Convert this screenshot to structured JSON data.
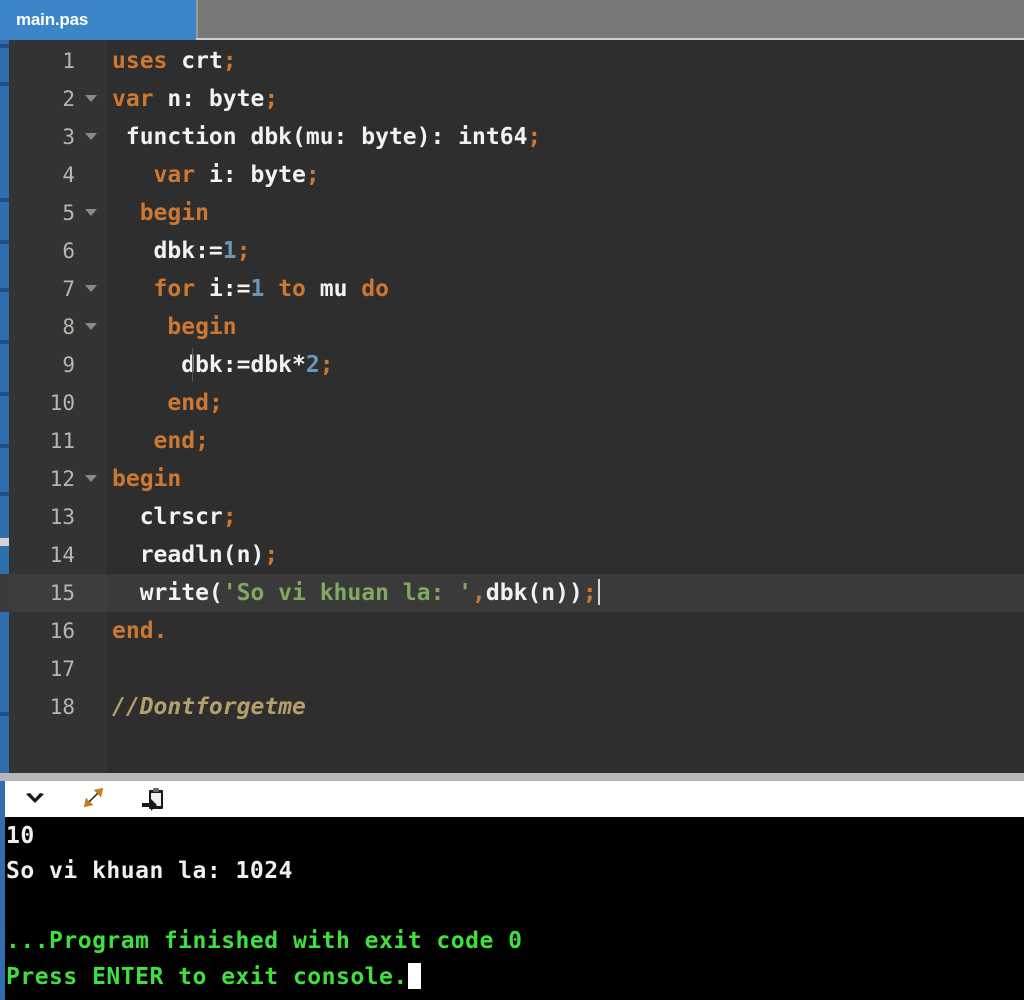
{
  "window": {
    "title": "main.pas",
    "theme": "dark-code-editor"
  },
  "colors": {
    "tab_active_bg": "#3a86c8",
    "tabbar_bg": "#787878",
    "editor_bg": "#2e2e2e",
    "gutter_bg": "#333333",
    "current_line_bg": "#3a3a3a",
    "keyword": "#cc7832",
    "number": "#6897bb",
    "string": "#81a85f",
    "comment": "#b3a06a",
    "identifier": "#f2f2f2",
    "console_bg": "#000000",
    "console_text": "#f0f0f0",
    "console_success": "#3ee03e",
    "accent_rail": "#2f6fb0"
  },
  "tabs": [
    {
      "label": "main.pas",
      "active": true
    }
  ],
  "editor": {
    "language": "pascal",
    "current_line": 15,
    "caret_line": 15,
    "lines": [
      {
        "n": 1,
        "fold": false,
        "indent_guide": false,
        "tokens": [
          {
            "t": "uses",
            "c": "kw"
          },
          {
            "t": " ",
            "c": "idn"
          },
          {
            "t": "crt",
            "c": "idn"
          },
          {
            "t": ";",
            "c": "pun"
          }
        ]
      },
      {
        "n": 2,
        "fold": true,
        "indent_guide": false,
        "tokens": [
          {
            "t": "var",
            "c": "kw"
          },
          {
            "t": " n: byte",
            "c": "idn"
          },
          {
            "t": ";",
            "c": "pun"
          }
        ]
      },
      {
        "n": 3,
        "fold": true,
        "indent_guide": false,
        "tokens": [
          {
            "t": " function dbk(mu: byte): int64",
            "c": "idn"
          },
          {
            "t": ";",
            "c": "pun"
          }
        ]
      },
      {
        "n": 4,
        "fold": false,
        "indent_guide": false,
        "tokens": [
          {
            "t": "   ",
            "c": "idn"
          },
          {
            "t": "var",
            "c": "kw"
          },
          {
            "t": " i: byte",
            "c": "idn"
          },
          {
            "t": ";",
            "c": "pun"
          }
        ]
      },
      {
        "n": 5,
        "fold": true,
        "indent_guide": false,
        "tokens": [
          {
            "t": "  ",
            "c": "idn"
          },
          {
            "t": "begin",
            "c": "kw"
          }
        ]
      },
      {
        "n": 6,
        "fold": false,
        "indent_guide": false,
        "tokens": [
          {
            "t": "   dbk:=",
            "c": "idn"
          },
          {
            "t": "1",
            "c": "num"
          },
          {
            "t": ";",
            "c": "pun"
          }
        ]
      },
      {
        "n": 7,
        "fold": true,
        "indent_guide": false,
        "tokens": [
          {
            "t": "   ",
            "c": "idn"
          },
          {
            "t": "for",
            "c": "kw"
          },
          {
            "t": " i:=",
            "c": "idn"
          },
          {
            "t": "1",
            "c": "num"
          },
          {
            "t": " ",
            "c": "idn"
          },
          {
            "t": "to",
            "c": "kw"
          },
          {
            "t": " mu ",
            "c": "idn"
          },
          {
            "t": "do",
            "c": "kw"
          }
        ]
      },
      {
        "n": 8,
        "fold": true,
        "indent_guide": false,
        "tokens": [
          {
            "t": "    ",
            "c": "idn"
          },
          {
            "t": "begin",
            "c": "kw"
          }
        ]
      },
      {
        "n": 9,
        "fold": false,
        "indent_guide": true,
        "tokens": [
          {
            "t": "     dbk:=dbk*",
            "c": "idn"
          },
          {
            "t": "2",
            "c": "num"
          },
          {
            "t": ";",
            "c": "pun"
          }
        ]
      },
      {
        "n": 10,
        "fold": false,
        "indent_guide": false,
        "tokens": [
          {
            "t": "    ",
            "c": "idn"
          },
          {
            "t": "end",
            "c": "kw"
          },
          {
            "t": ";",
            "c": "pun"
          }
        ]
      },
      {
        "n": 11,
        "fold": false,
        "indent_guide": false,
        "tokens": [
          {
            "t": "   ",
            "c": "idn"
          },
          {
            "t": "end",
            "c": "kw"
          },
          {
            "t": ";",
            "c": "pun"
          }
        ]
      },
      {
        "n": 12,
        "fold": true,
        "indent_guide": false,
        "tokens": [
          {
            "t": "begin",
            "c": "kw"
          }
        ]
      },
      {
        "n": 13,
        "fold": false,
        "indent_guide": false,
        "tokens": [
          {
            "t": "  clrscr",
            "c": "idn"
          },
          {
            "t": ";",
            "c": "pun"
          }
        ]
      },
      {
        "n": 14,
        "fold": false,
        "indent_guide": false,
        "tokens": [
          {
            "t": "  readln(n)",
            "c": "idn"
          },
          {
            "t": ";",
            "c": "pun"
          }
        ]
      },
      {
        "n": 15,
        "fold": false,
        "indent_guide": false,
        "caret": true,
        "tokens": [
          {
            "t": "  write(",
            "c": "idn"
          },
          {
            "t": "'So vi khuan la: '",
            "c": "str"
          },
          {
            "t": ",",
            "c": "pun"
          },
          {
            "t": "dbk(n))",
            "c": "idn"
          },
          {
            "t": ";",
            "c": "pun"
          }
        ]
      },
      {
        "n": 16,
        "fold": false,
        "indent_guide": false,
        "tokens": [
          {
            "t": "end",
            "c": "kw"
          },
          {
            "t": ".",
            "c": "pun"
          }
        ]
      },
      {
        "n": 17,
        "fold": false,
        "indent_guide": false,
        "tokens": []
      },
      {
        "n": 18,
        "fold": false,
        "indent_guide": false,
        "tokens": [
          {
            "t": "//Dontforgetme",
            "c": "cmt"
          }
        ]
      }
    ]
  },
  "toolbar": {
    "buttons": [
      {
        "name": "collapse-console-button",
        "icon": "chevron-down-icon",
        "tooltip": "Collapse"
      },
      {
        "name": "expand-console-button",
        "icon": "expand-diagonal-icon",
        "tooltip": "Maximize"
      },
      {
        "name": "copy-output-button",
        "icon": "clipboard-icon",
        "tooltip": "Copy"
      }
    ]
  },
  "console": {
    "lines": [
      {
        "text": "10",
        "style": "out"
      },
      {
        "text": "So vi khuan la: 1024",
        "style": "out"
      },
      {
        "text": "",
        "style": "out"
      },
      {
        "text": "...Program finished with exit code 0",
        "style": "ok"
      },
      {
        "text": "Press ENTER to exit console.",
        "style": "ok",
        "cursor": true
      }
    ],
    "exit_code": "0",
    "input_value": "10",
    "program_output": "So vi khuan la: 1024"
  }
}
